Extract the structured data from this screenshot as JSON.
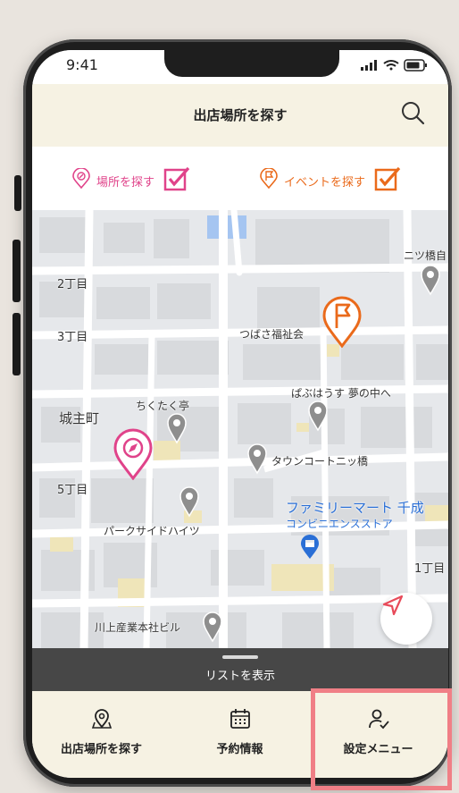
{
  "status_bar": {
    "time": "9:41"
  },
  "header": {
    "title": "出店場所を探す"
  },
  "filters": [
    {
      "label": "場所を探す",
      "checked": true,
      "color": "#e0438a"
    },
    {
      "label": "イベントを探す",
      "checked": true,
      "color": "#ea6a1b"
    }
  ],
  "map": {
    "labels": {
      "chome2": "2丁目",
      "chome3": "3丁目",
      "chome5": "5丁目",
      "chome1": "1丁目",
      "jonushi": "城主町",
      "futatsubashi": "ニツ橋自",
      "tsubasa": "つばさ福祉会",
      "pubuhouse": "ぱぶはうす 夢の中へ",
      "chikutaku": "ちくたく亭",
      "towncourt": "タウンコートニッ橋",
      "familymart": "ファミリーマート 千成",
      "convenience": "コンビニエンスストア",
      "parkside": "パークサイドハイツ",
      "kawakami": "川上産業本社ビル"
    }
  },
  "list_bar": {
    "label": "リストを表示"
  },
  "tabs": [
    {
      "label": "出店場所を探す",
      "icon": "location-pin-icon"
    },
    {
      "label": "予約情報",
      "icon": "calendar-icon"
    },
    {
      "label": "設定メニュー",
      "icon": "user-settings-icon"
    }
  ],
  "colors": {
    "place_pink": "#e0438a",
    "event_orange": "#ea6a1b",
    "header_bg": "#f6f2e3",
    "highlight": "#f07f86"
  }
}
